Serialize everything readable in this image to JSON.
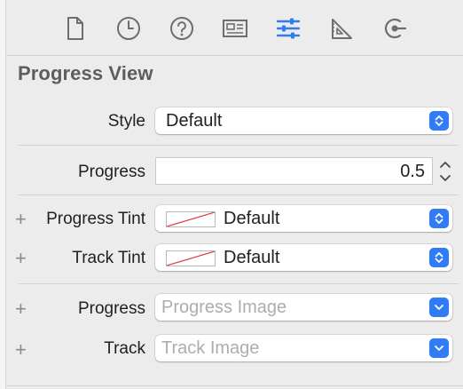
{
  "toolbar": {
    "tabs": [
      {
        "name": "file-inspector",
        "icon": "document-icon"
      },
      {
        "name": "history-inspector",
        "icon": "clock-icon"
      },
      {
        "name": "quick-help-inspector",
        "icon": "question-mark-icon"
      },
      {
        "name": "identity-inspector",
        "icon": "identity-card-icon"
      },
      {
        "name": "attributes-inspector",
        "icon": "sliders-icon",
        "selected": true
      },
      {
        "name": "size-inspector",
        "icon": "ruler-triangle-icon"
      },
      {
        "name": "connections-inspector",
        "icon": "connection-arrow-icon"
      }
    ]
  },
  "section": {
    "title": "Progress View"
  },
  "fields": {
    "style": {
      "label": "Style",
      "value": "Default"
    },
    "progress": {
      "label": "Progress",
      "value": "0.5"
    },
    "progress_tint": {
      "label": "Progress Tint",
      "value": "Default"
    },
    "track_tint": {
      "label": "Track Tint",
      "value": "Default"
    },
    "progress_image": {
      "label": "Progress",
      "placeholder": "Progress Image"
    },
    "track_image": {
      "label": "Track",
      "placeholder": "Track Image"
    }
  },
  "colors": {
    "accent": "#2f7cf6",
    "icon_gray": "#6e6e6e",
    "placeholder": "#adadad"
  }
}
